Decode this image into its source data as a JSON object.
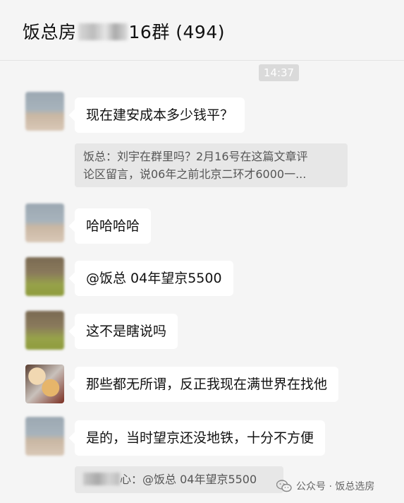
{
  "header": {
    "title_prefix": "饭总房",
    "title_suffix": "16群 (494)"
  },
  "time_label": "14:37",
  "messages": [
    {
      "text": "现在建安成本多少钱平？"
    },
    {
      "text": "哈哈哈哈"
    },
    {
      "text": "@饭总 04年望京5500"
    },
    {
      "text": "这不是瞎说吗"
    },
    {
      "text": "那些都无所谓，反正我现在满世界在找他"
    },
    {
      "text": "是的，当时望京还没地铁，十分不方便"
    }
  ],
  "quotes": [
    {
      "line1": "饭总：刘宇在群里吗？2月16号在这篇文章评",
      "line2": "论区留言，说06年之前北京二环才6000一..."
    },
    {
      "suffix": "心：@饭总 04年望京5500"
    }
  ],
  "watermark": {
    "text": "公众号 · 饭总选房",
    "icon": "wechat-icon"
  }
}
